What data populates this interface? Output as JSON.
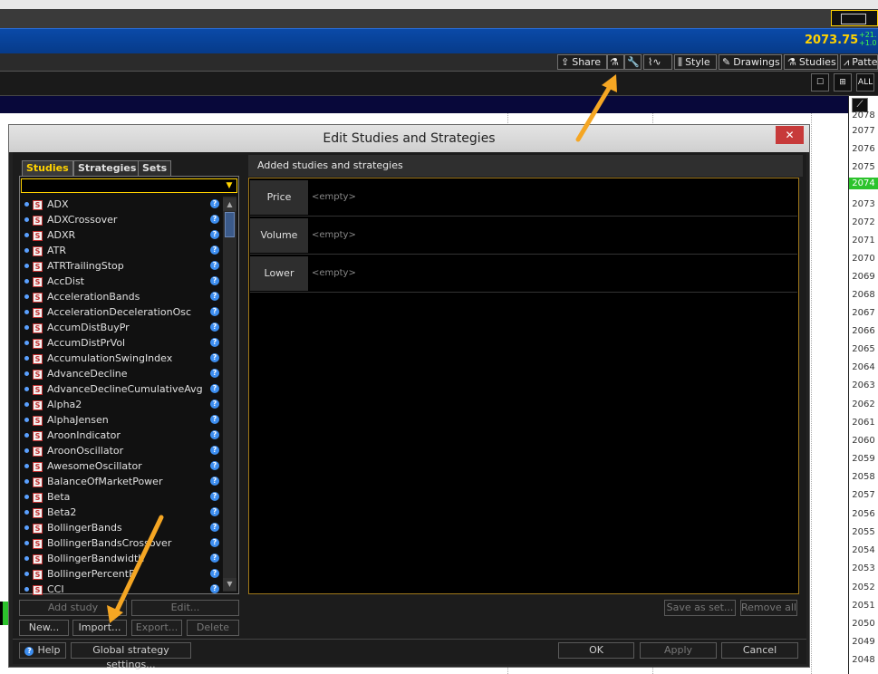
{
  "header": {
    "price": "2073.75",
    "change_line1": "+21.",
    "change_line2": "+1.0"
  },
  "toolbar": {
    "share": "Share",
    "style": "Style",
    "drawings": "Drawings",
    "studies": "Studies",
    "patterns": "Patte"
  },
  "view_buttons": {
    "all": "ALL"
  },
  "axis": {
    "ticks": [
      "2078",
      "2077",
      "2076",
      "2075",
      "2073",
      "2072",
      "2071",
      "2070",
      "2069",
      "2068",
      "2067",
      "2066",
      "2065",
      "2064",
      "2063",
      "2062",
      "2061",
      "2060",
      "2059",
      "2058",
      "2057",
      "2056",
      "2055",
      "2054",
      "2053",
      "2052",
      "2051",
      "2050",
      "2049",
      "2048"
    ],
    "last_price": "2074"
  },
  "dialog": {
    "title": "Edit Studies and Strategies",
    "close": "✕",
    "tabs": [
      "Studies",
      "Strategies",
      "Sets"
    ],
    "filter_value": "",
    "studies": [
      "ADX",
      "ADXCrossover",
      "ADXR",
      "ATR",
      "ATRTrailingStop",
      "AccDist",
      "AccelerationBands",
      "AccelerationDecelerationOsc",
      "AccumDistBuyPr",
      "AccumDistPrVol",
      "AccumulationSwingIndex",
      "AdvanceDecline",
      "AdvanceDeclineCumulativeAvg",
      "Alpha2",
      "AlphaJensen",
      "AroonIndicator",
      "AroonOscillator",
      "AwesomeOscillator",
      "BalanceOfMarketPower",
      "Beta",
      "Beta2",
      "BollingerBands",
      "BollingerBandsCrossover",
      "BollingerBandwidth",
      "BollingerPercentB",
      "CCI"
    ],
    "added_header": "Added studies and strategies",
    "sections": [
      {
        "label": "Price",
        "value": "<empty>"
      },
      {
        "label": "Volume",
        "value": "<empty>"
      },
      {
        "label": "Lower",
        "value": "<empty>"
      }
    ],
    "buttons": {
      "add_study": "Add study",
      "edit": "Edit...",
      "new": "New...",
      "import": "Import...",
      "export": "Export...",
      "delete": "Delete",
      "save_as_set": "Save as set...",
      "remove_all": "Remove all",
      "help": "Help",
      "global_settings": "Global strategy settings...",
      "ok": "OK",
      "apply": "Apply",
      "cancel": "Cancel"
    }
  },
  "colors": {
    "accent": "#ffd200",
    "arrow": "#f5a623",
    "blue_bar": "#0a4aa8"
  }
}
